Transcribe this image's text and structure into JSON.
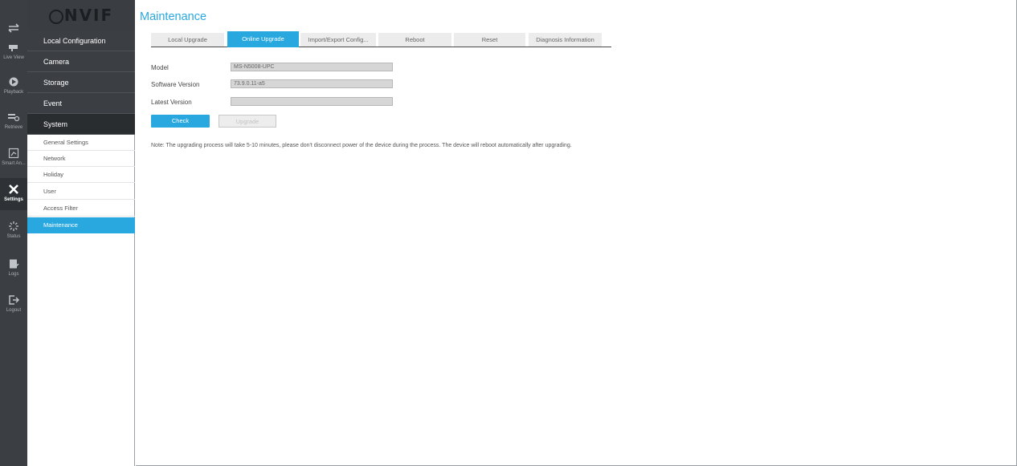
{
  "rail": {
    "items": [
      {
        "label": "",
        "icon": "swap-arrows-icon"
      },
      {
        "label": "Live View",
        "icon": "camera-icon"
      },
      {
        "label": "Playback",
        "icon": "playback-icon"
      },
      {
        "label": "Retrieve",
        "icon": "retrieve-icon"
      },
      {
        "label": "Smart An...",
        "icon": "smart-analysis-icon"
      },
      {
        "label": "Settings",
        "icon": "settings-tools-icon"
      },
      {
        "label": "Status",
        "icon": "status-icon"
      },
      {
        "label": "Logs",
        "icon": "logs-icon"
      },
      {
        "label": "Logout",
        "icon": "logout-icon"
      }
    ]
  },
  "logo": {
    "text": "NVIF"
  },
  "nav": {
    "sections": [
      "Local Configuration",
      "Camera",
      "Storage",
      "Event",
      "System"
    ],
    "system_items": [
      "General Settings",
      "Network",
      "Holiday",
      "User",
      "Access Filter",
      "Maintenance"
    ]
  },
  "page": {
    "title": "Maintenance"
  },
  "tabs": [
    "Local Upgrade",
    "Online Upgrade",
    "Import/Export Config...",
    "Reboot",
    "Reset",
    "Diagnosis Information"
  ],
  "form": {
    "model_label": "Model",
    "model_value": "MS-N5008-UPC",
    "software_label": "Software Version",
    "software_value": "73.9.0.11-a5",
    "latest_label": "Latest Version",
    "latest_value": ""
  },
  "buttons": {
    "check": "Check",
    "upgrade": "Upgrade"
  },
  "note": "Note: The upgrading process will take 5-10 minutes, please don't disconnect power of the device during the process. The device will reboot automatically after upgrading.",
  "colors": {
    "accent": "#29a8e0",
    "rail_bg": "#3b3f43",
    "nav_section_bg": "#3b3f43"
  }
}
